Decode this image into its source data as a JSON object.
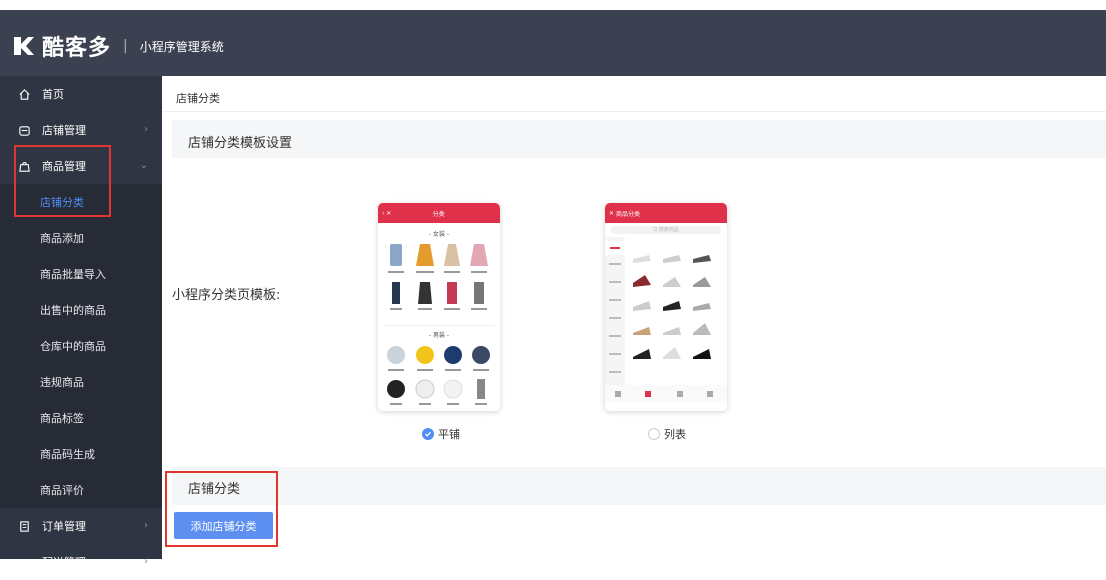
{
  "brand": {
    "name": "酷客多",
    "separator": "|",
    "subtitle": "小程序管理系统"
  },
  "sidebar": {
    "items": [
      {
        "label": "首页",
        "icon": "home-icon"
      },
      {
        "label": "店铺管理",
        "icon": "store-icon"
      },
      {
        "label": "商品管理",
        "icon": "bag-icon"
      }
    ],
    "sub_items": [
      "店铺分类",
      "商品添加",
      "商品批量导入",
      "出售中的商品",
      "仓库中的商品",
      "违规商品",
      "商品标签",
      "商品码生成",
      "商品评价"
    ],
    "bottom_items": [
      {
        "label": "订单管理",
        "icon": "order-icon"
      },
      {
        "label": "配送管理",
        "icon": "delivery-icon"
      }
    ]
  },
  "main": {
    "breadcrumb": "店铺分类",
    "template_section_title": "店铺分类模板设置",
    "template_label": "小程序分类页模板:",
    "option_tile": "平铺",
    "option_list": "列表",
    "category_section_title": "店铺分类",
    "add_button": "添加店铺分类"
  },
  "phone_tile": {
    "title": "分类",
    "group1": "- 女装 -",
    "group2": "- 男装 -"
  },
  "phone_list": {
    "title": "商品分类",
    "search": "Q 搜索商品"
  },
  "colors": {
    "accent": "#4f8ef7",
    "topbar": "#3b4150",
    "sidebar": "#2f3542",
    "phone_header": "#e0314b",
    "highlight": "#e0362f"
  }
}
